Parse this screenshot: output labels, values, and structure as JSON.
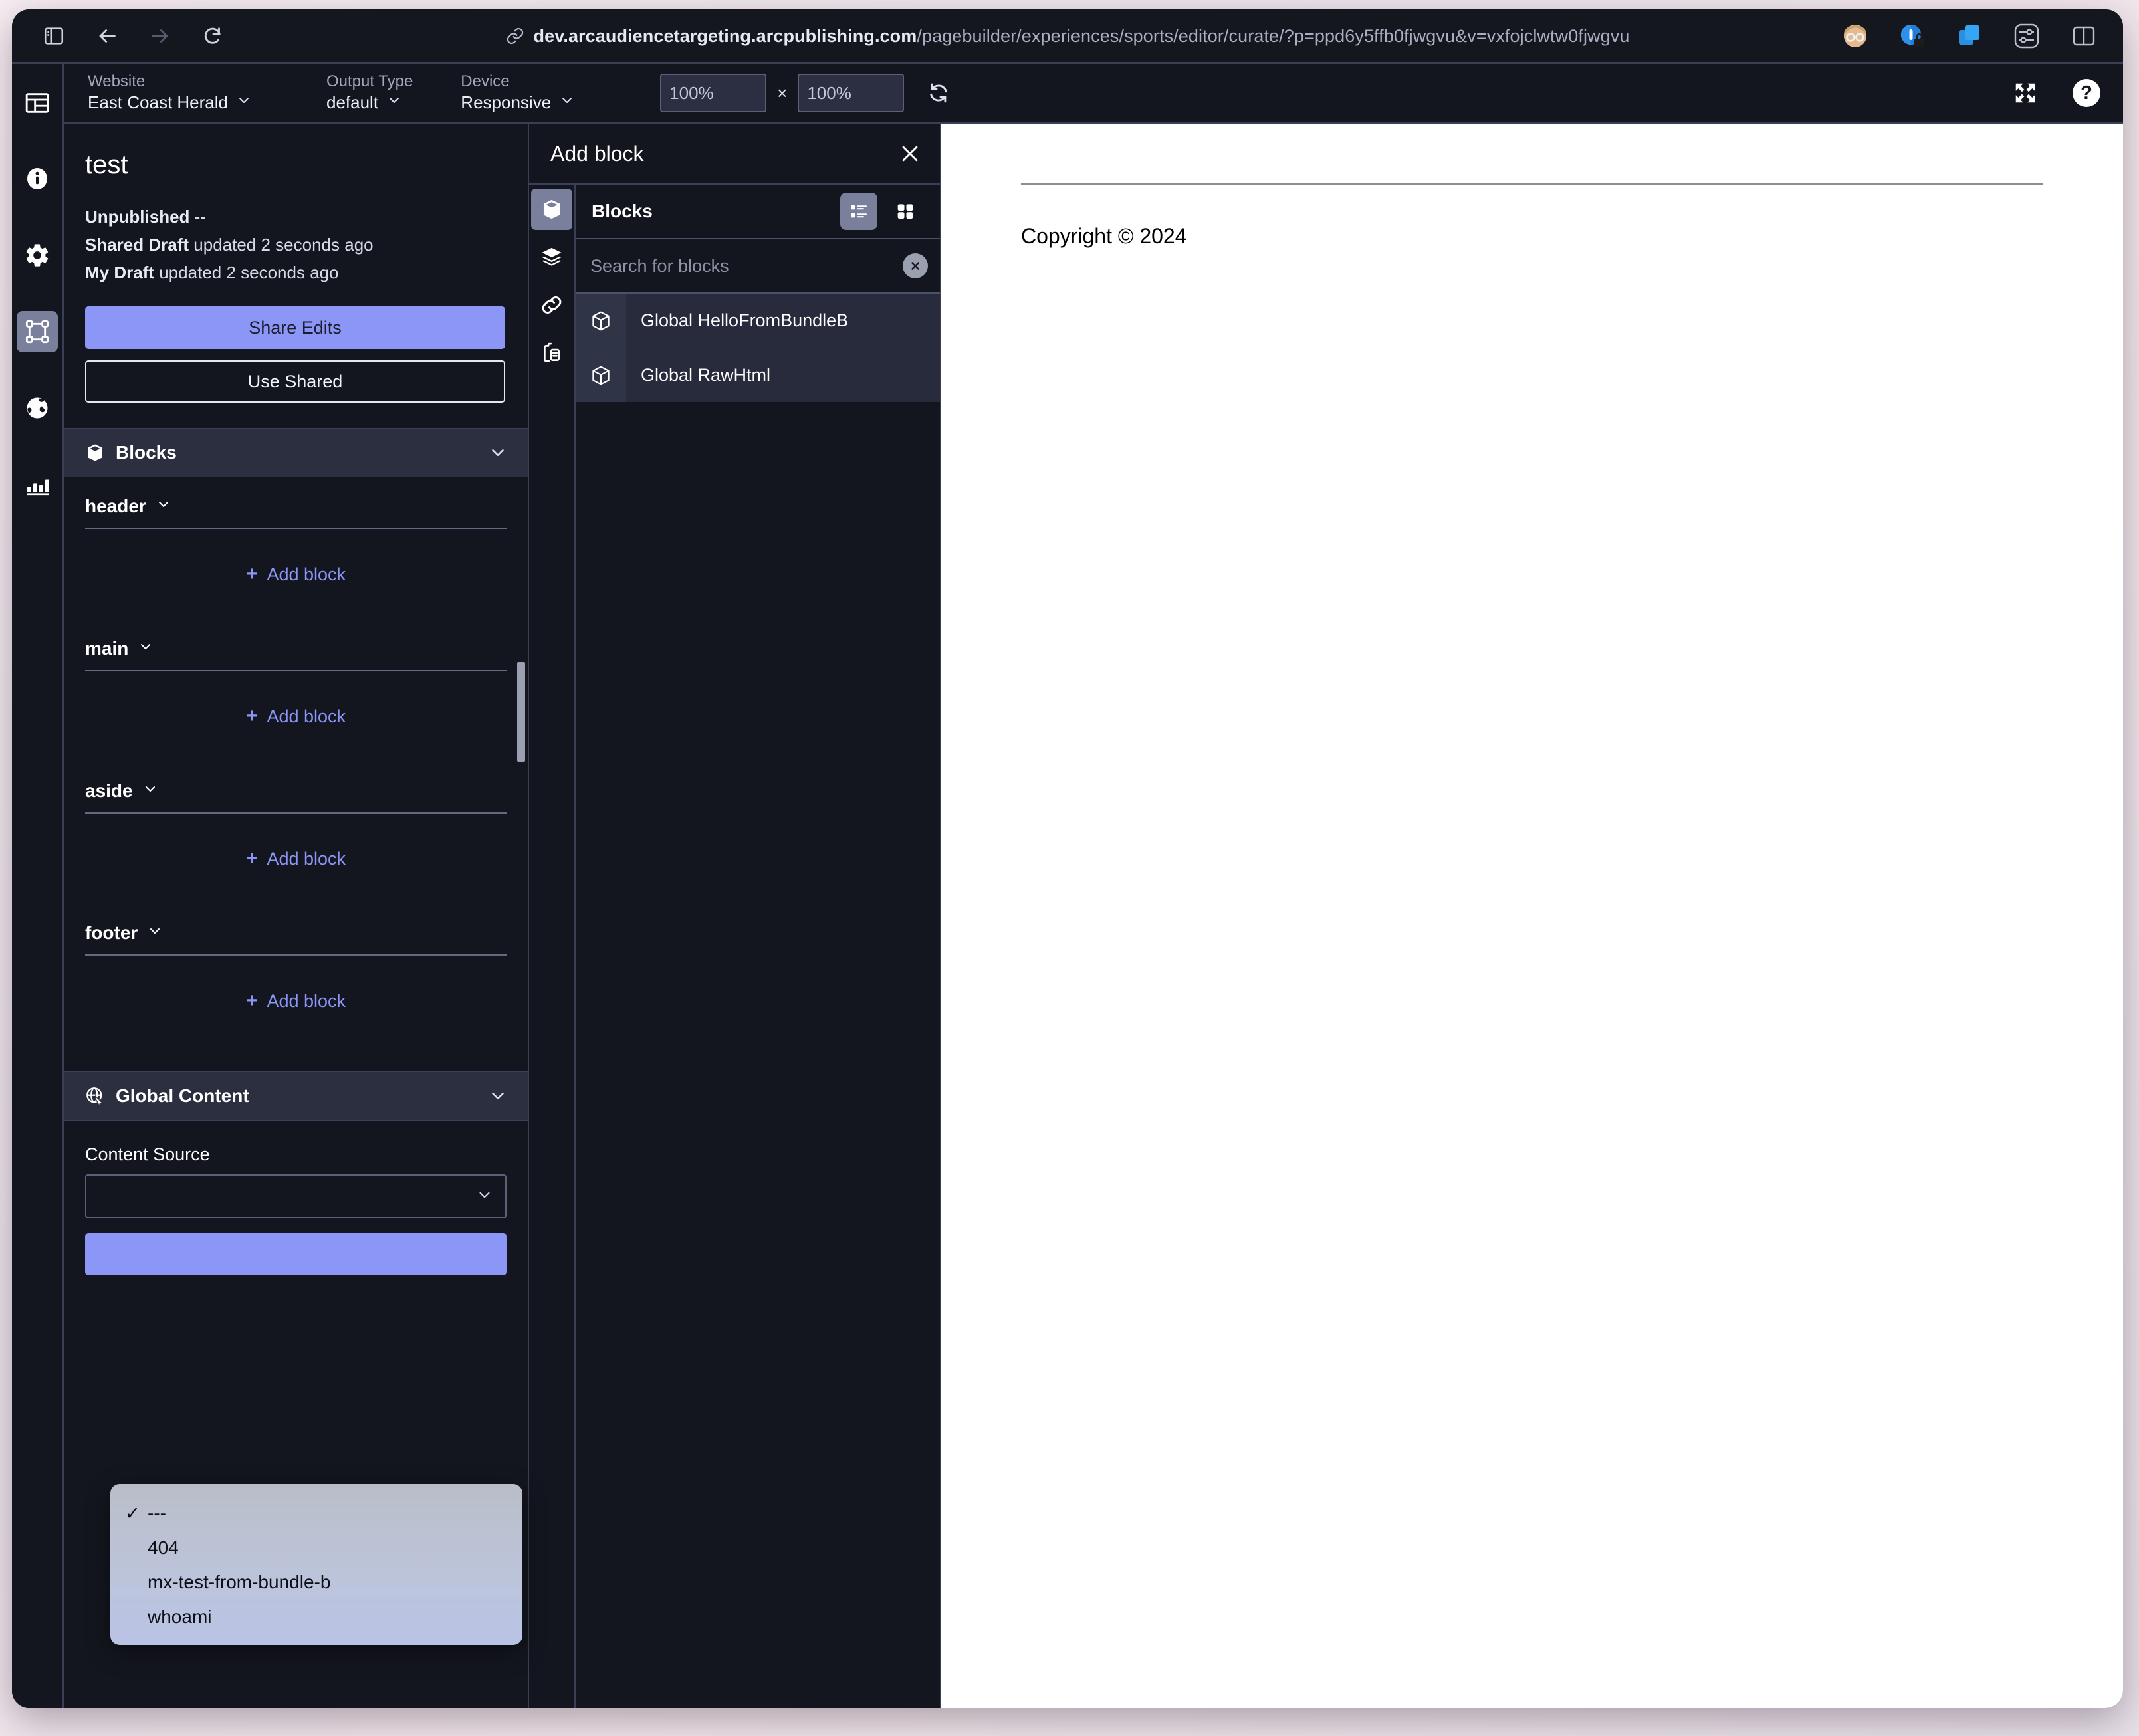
{
  "browser": {
    "url_host": "dev.arcaudiencetargeting.arcpublishing.com",
    "url_path": "/pagebuilder/experiences/sports/editor/curate/?p=ppd6y5ffb0fjwgvu&v=vxfojclwtw0fjwgvu",
    "nav": {
      "sidebar_toggle": "sidebar-toggle",
      "back": "back",
      "forward": "forward",
      "reload": "reload"
    },
    "right_icons": [
      "profile-avatar",
      "privacy-lock",
      "extensions",
      "settings-sliders",
      "split-view"
    ]
  },
  "rail": {
    "items": [
      {
        "name": "layout-icon",
        "label": "Layout"
      },
      {
        "name": "info-icon",
        "label": "Info"
      },
      {
        "name": "gear-icon",
        "label": "Settings"
      },
      {
        "name": "selection-frame-icon",
        "label": "Blocks",
        "active": true
      },
      {
        "name": "globe-icon",
        "label": "Global"
      },
      {
        "name": "bar-chart-icon",
        "label": "Analytics"
      }
    ]
  },
  "toolbar": {
    "website_label": "Website",
    "website_value": "East Coast Herald",
    "output_type_label": "Output Type",
    "output_type_value": "default",
    "device_label": "Device",
    "device_value": "Responsive",
    "zoom_width": "100%",
    "zoom_height": "100%",
    "zoom_separator": "×",
    "refresh": "refresh",
    "expand": "expand",
    "help": "?"
  },
  "sidebar": {
    "title": "test",
    "status": {
      "unpublished_label": "Unpublished",
      "unpublished_value": "--",
      "shared_draft_label": "Shared Draft",
      "shared_draft_value": "updated 2 seconds ago",
      "my_draft_label": "My Draft",
      "my_draft_value": "updated 2 seconds ago"
    },
    "share_edits_label": "Share Edits",
    "use_shared_label": "Use Shared",
    "blocks_section": {
      "label": "Blocks",
      "groups": [
        {
          "name": "header",
          "add_label": "Add block"
        },
        {
          "name": "main",
          "add_label": "Add block"
        },
        {
          "name": "aside",
          "add_label": "Add block"
        },
        {
          "name": "footer",
          "add_label": "Add block"
        }
      ]
    },
    "global_content_section": {
      "label": "Global Content",
      "content_source_label": "Content Source"
    }
  },
  "select_popup": {
    "options": [
      {
        "label": "---",
        "selected": true
      },
      {
        "label": "404",
        "selected": false
      },
      {
        "label": "mx-test-from-bundle-b",
        "selected": false
      },
      {
        "label": "whoami",
        "selected": false
      }
    ],
    "check_glyph": "✓"
  },
  "add_block": {
    "title": "Add block",
    "close": "close",
    "rail": [
      {
        "name": "cube-icon",
        "active": true
      },
      {
        "name": "layers-icon",
        "active": false
      },
      {
        "name": "link-icon",
        "active": false
      },
      {
        "name": "clipboard-icon",
        "active": false
      }
    ],
    "blocks_label": "Blocks",
    "view_list": "list-view",
    "view_grid": "grid-view",
    "search_placeholder": "Search for blocks",
    "search_value": "",
    "clear_label": "×",
    "items": [
      {
        "label": "Global HelloFromBundleB"
      },
      {
        "label": "Global RawHtml"
      }
    ]
  },
  "preview": {
    "copyright": "Copyright © 2024"
  },
  "colors": {
    "accent": "#8b96f7",
    "panel_bg": "#14161f",
    "section_bg": "#2b2f3f",
    "border": "#3a3f55",
    "active_rail": "#7a7f9c"
  }
}
